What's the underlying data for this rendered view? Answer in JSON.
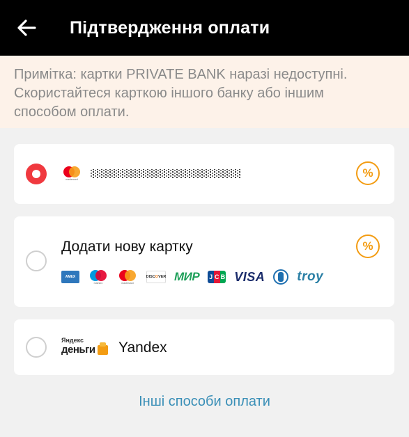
{
  "header": {
    "title": "Підтвердження оплати",
    "back_icon": "arrow-left-icon",
    "background": "#000000"
  },
  "notice": {
    "text_line1": "Примітка: картки PRIVATE BANK наразі недоступні.",
    "text_line2": "Скористайтеся карткою іншого банку або іншим",
    "text_line3": "способом оплати."
  },
  "payment_options": {
    "saved_card": {
      "selected": true,
      "brand": "Mastercard",
      "number_masked": "••••••••••••••••",
      "promo_label": "%"
    },
    "add_card": {
      "label": "Додати нову картку",
      "promo_label": "%",
      "brands": [
        "American Express",
        "Maestro",
        "Mastercard",
        "Discover",
        "МИР",
        "JCB",
        "VISA",
        "Diners Club",
        "troy"
      ],
      "mir_label": "МИР",
      "visa_label": "VISA",
      "troy_label": "troy",
      "jcb_label": "JCB"
    },
    "yandex": {
      "logo_small": "Яндекс",
      "logo_big": "деньги",
      "label": "Yandex"
    }
  },
  "footer": {
    "other_methods_label": "Інші способи оплати"
  },
  "colors": {
    "accent_red": "#f0393f",
    "promo_orange": "#f39c12",
    "link_blue": "#3a8fb7",
    "notice_bg": "#fdf2e9"
  }
}
